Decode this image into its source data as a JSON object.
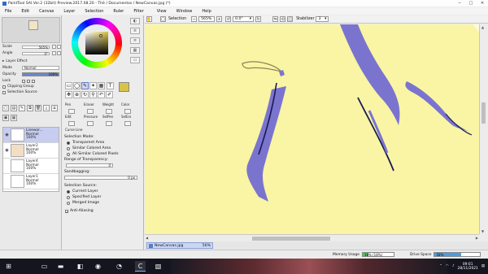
{
  "window": {
    "title": "PaintTool SAI Ver.2 (32bit) Preview.2017.08.20 - Thé / Documentos / NewCanvas.jpg (*)",
    "controls": [
      "─",
      "□",
      "✕"
    ]
  },
  "menu": {
    "items": [
      "File",
      "Edit",
      "Canvas",
      "Layer",
      "Selection",
      "Ruler",
      "Filter",
      "View",
      "Window",
      "Help"
    ]
  },
  "navigator": {
    "scale_label": "Scale",
    "scale_value": "565%",
    "angle_label": "Angle",
    "angle_value": "0°"
  },
  "layer_settings": {
    "section_title": "Layer Effect",
    "mode_label": "Mode",
    "mode_value": "Normal",
    "opacity_label": "Opacity",
    "opacity_value": "100%",
    "lock_label": "Lock",
    "clipping_group": "Clipping Group",
    "selection_source": "Selection Source"
  },
  "layers": [
    {
      "name": "Linewor...",
      "mode": "Normal",
      "opacity": "100%",
      "selected": true
    },
    {
      "name": "Layer2",
      "mode": "Normal",
      "opacity": "100%",
      "selected": false
    },
    {
      "name": "Layer4",
      "mode": "Normal",
      "opacity": "100%",
      "selected": false
    },
    {
      "name": "Layer1",
      "mode": "Normal",
      "opacity": "100%",
      "selected": false
    }
  ],
  "colors": {
    "canvas_bg": "#f9f5a4",
    "stroke_purple": "#7b74cf",
    "line_dark": "#1a1a55",
    "current_color": "#d8c349",
    "selected_layer": "#c6cdf0"
  },
  "tool_grid": {
    "rows": [
      [
        "▭",
        "◯",
        "✎",
        "✦",
        "▦",
        "",
        "",
        "T"
      ],
      [
        "✥",
        "⊕",
        "↻",
        "⚲",
        "↶",
        "✐"
      ]
    ]
  },
  "brushes": {
    "row1": [
      "Pen",
      "Eraser",
      "Weight",
      "Color"
    ],
    "row2": [
      "Edit",
      "Pressure",
      "SelPen",
      "SelErs"
    ],
    "row3_partial": "Curve    Line"
  },
  "selection_options": {
    "mode_title": "Selection Mode:",
    "modes": [
      "Transparent Area",
      "Similar Colored Area",
      "All Similar Colored Pixels"
    ],
    "range_title": "Range of Transparency:",
    "range_value": "0",
    "sandbagging_title": "Sandbagging:",
    "sandbagging_value": "0 px",
    "source_title": "Selection Source:",
    "sources": [
      "Current Layer",
      "Specified Layer",
      "Merged Image"
    ],
    "antialias": "Anti-Aliasing"
  },
  "canvas_toolbar": {
    "selection_label": "Selection",
    "zoom_value": "565%",
    "angle_value": "0.0°",
    "stabilizer_label": "Stabilizer",
    "stabilizer_value": "3"
  },
  "document": {
    "tab_name": "NewCanvas.jpg",
    "tab_zoom": "56%"
  },
  "status": {
    "memory_label": "Memory Usage",
    "memory_text": "18% (18%)",
    "memory_fraction": 0.18,
    "drive_label": "Drive Space",
    "drive_text": "58%",
    "drive_fraction": 0.58
  },
  "taskbar": {
    "time": "09:01",
    "date": "28/11/2021"
  }
}
